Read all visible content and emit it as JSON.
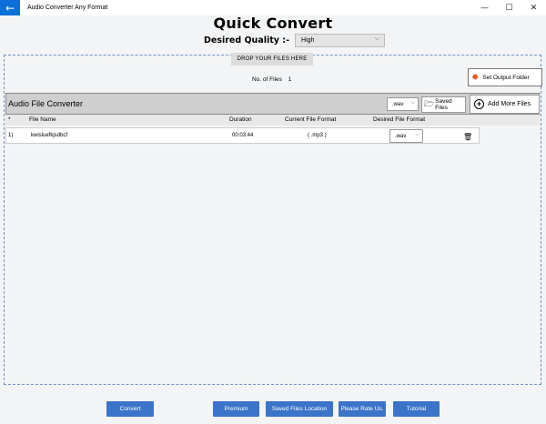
{
  "window": {
    "app_title": "Audio Converter Any Format",
    "back_icon": "←",
    "minimize_icon": "—",
    "maximize_icon": "☐",
    "close_icon": "✕"
  },
  "main_title": "Quick Convert",
  "quality": {
    "label": "Desired Quality :-",
    "value": "High",
    "chevron": "⌵"
  },
  "drop": {
    "label": "DROP YOUR FILES HERE"
  },
  "files_count": {
    "label": "No. of Files",
    "value": "1"
  },
  "output_folder": {
    "label": "Set Output Folder",
    "icon": "✹"
  },
  "converter": {
    "title": "Audio File Converter",
    "format_value": ".wav",
    "chevron": "⌵",
    "saved_files_label": "Saved Files",
    "folder_icon": "🗁",
    "add_more_label": "Add More Files",
    "add_icon": "+"
  },
  "table": {
    "headers": {
      "index": "*",
      "file_name": "File Name",
      "duration": "Duration",
      "current_format": "Current File Format",
      "desired_format": "Desired File Format"
    },
    "rows": [
      {
        "index": "1)",
        "file_name": "kwisluefkjsdbcf",
        "duration": "00:03:44",
        "current_format": "( .mp3 )",
        "desired_format": ".wav",
        "delete_icon": "🗑"
      }
    ]
  },
  "bottom_buttons": {
    "convert": "Convert",
    "premium": "Premium",
    "saved_location": "Saved Files Location",
    "rate": "Please Rate Us.",
    "tutorial": "Tutorial"
  },
  "colors": {
    "accent_blue": "#3b74c9",
    "titlebar_back": "#0a6fd6",
    "gear_orange": "#e4571f"
  }
}
